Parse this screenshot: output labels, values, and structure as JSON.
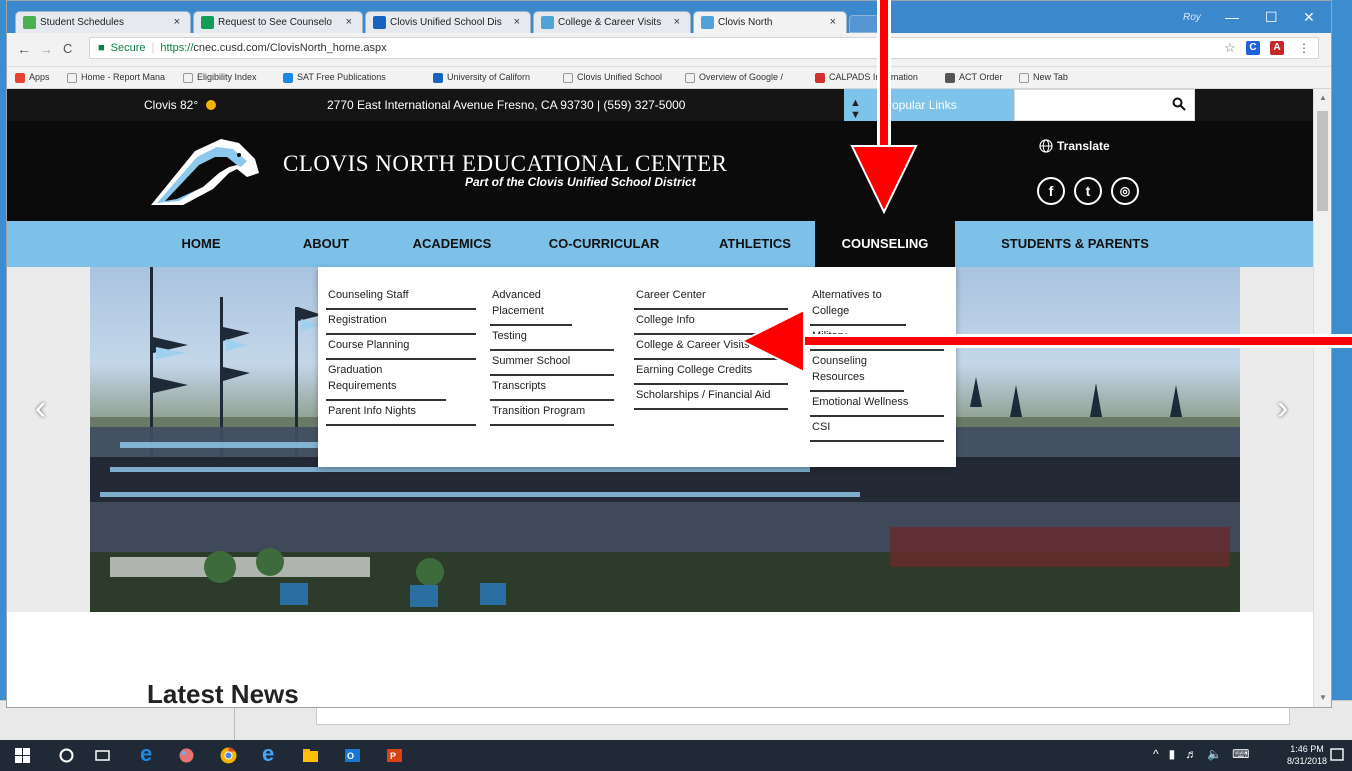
{
  "browser": {
    "tabs": [
      {
        "title": "Student Schedules",
        "color": "#4caf50"
      },
      {
        "title": "Request to See Counselo",
        "color": "#0f9d58"
      },
      {
        "title": "Clovis Unified School Dis",
        "color": "#1565c0"
      },
      {
        "title": "College & Career Visits",
        "color": "#4fa3d9"
      },
      {
        "title": "Clovis North",
        "color": "#4fa3d9"
      }
    ],
    "close_glyph": "×",
    "user_label": "Roy",
    "secure_label": "Secure",
    "url_scheme": "https://",
    "url_rest": "cnec.cusd.com/ClovisNorth_home.aspx",
    "bookmarks": [
      {
        "label": "Apps",
        "color": "#e94235"
      },
      {
        "label": "Home - Report Mana",
        "color": "#999"
      },
      {
        "label": "Eligibility Index",
        "color": "#999"
      },
      {
        "label": "SAT Free Publications",
        "color": "#1e88e5"
      },
      {
        "label": "University of Californ",
        "color": "#1565c0"
      },
      {
        "label": "Clovis Unified School",
        "color": "#999"
      },
      {
        "label": "Overview of Google /",
        "color": "#999"
      },
      {
        "label": "CALPADS Information",
        "color": "#d32f2f"
      },
      {
        "label": "ACT Order",
        "color": "#555"
      },
      {
        "label": "New Tab",
        "color": "#999"
      }
    ]
  },
  "site": {
    "weather": "Clovis 82°",
    "address": "2770 East International Avenue Fresno, CA 93730  |  (559) 327-5000",
    "popular_links": "Popular Links",
    "school_name": "CLOVIS NORTH EDUCATIONAL CENTER",
    "district": "Part of the Clovis Unified School District",
    "translate": "Translate",
    "nav": [
      {
        "label": "HOME"
      },
      {
        "label": "ABOUT"
      },
      {
        "label": "ACADEMICS"
      },
      {
        "label": "CO-CURRICULAR"
      },
      {
        "label": "ATHLETICS"
      },
      {
        "label": "COUNSELING"
      },
      {
        "label": "STUDENTS & PARENTS"
      }
    ],
    "dropdown": {
      "col1": [
        "Counseling Staff",
        "Registration",
        "Course Planning",
        "Graduation Requirements",
        "Parent Info Nights"
      ],
      "col2": [
        "Advanced Placement",
        "Testing",
        "Summer School",
        "Transcripts",
        "Transition Program"
      ],
      "col3": [
        "Career Center",
        "College Info",
        "College & Career Visits",
        "Earning College Credits",
        "Scholarships / Financial Aid"
      ],
      "col4": [
        "Alternatives to College",
        "Military",
        "Counseling Resources",
        "Emotional Wellness",
        "CSI"
      ]
    },
    "latest_news": "Latest News"
  },
  "taskbar": {
    "time": "1:46 PM",
    "date": "8/31/2018"
  },
  "accent": {
    "nav_blue": "#7dc1e8",
    "annotation_red": "#ff0000"
  }
}
